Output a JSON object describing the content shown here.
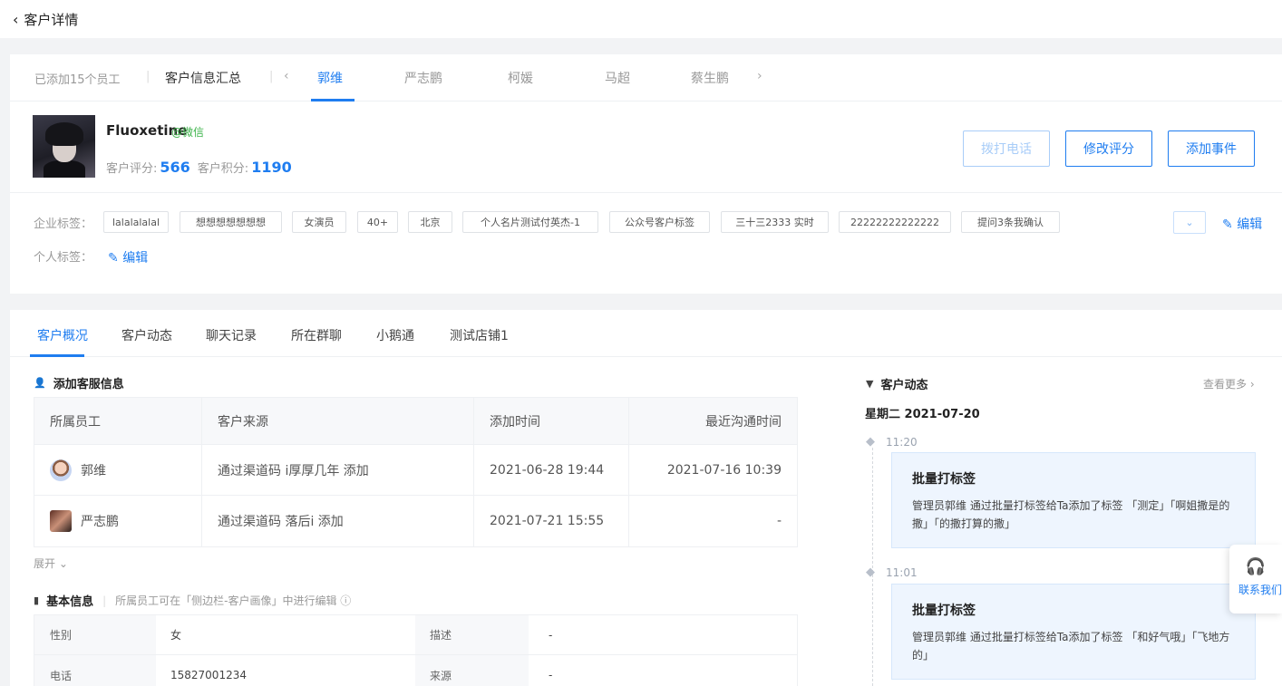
{
  "header": {
    "back_icon": "‹",
    "title": "客户详情"
  },
  "employees": {
    "added_text": "已添加15个员工",
    "summary_label": "客户信息汇总",
    "prev_arrow": "‹",
    "next_arrow": "›",
    "tabs": [
      "郭维",
      "严志鹏",
      "柯媛",
      "马超",
      "蔡生鹏"
    ],
    "active_index": 0
  },
  "customer": {
    "name": "Fluoxetine",
    "source": "@微信",
    "score_label": "客户评分:",
    "score": "566",
    "points_label": "客户积分:",
    "points": "1190"
  },
  "actions": {
    "call": "拨打电话",
    "modify_score": "修改评分",
    "add_event": "添加事件"
  },
  "tags": {
    "enterprise_label": "企业标签：",
    "personal_label": "个人标签：",
    "edit": "编辑",
    "enterprise": [
      "lalalalalal",
      "想想想想想想想",
      "女演员",
      "40+",
      "北京",
      "个人名片测试付英杰-1",
      "公众号客户标签",
      "三十三2333 实时",
      "22222222222222",
      "提问3条我确认"
    ]
  },
  "main_tabs": [
    "客户概况",
    "客户动态",
    "聊天记录",
    "所在群聊",
    "小鹅通",
    "测试店铺1"
  ],
  "service": {
    "title": "添加客服信息",
    "columns": [
      "所属员工",
      "客户来源",
      "添加时间",
      "最近沟通时间"
    ],
    "rows": [
      {
        "employee": "郭维",
        "source": "通过渠道码 i厚厚几年 添加",
        "added": "2021-06-28 19:44",
        "last": "2021-07-16 10:39"
      },
      {
        "employee": "严志鹏",
        "source": "通过渠道码 落后i 添加",
        "added": "2021-07-21 15:55",
        "last": "-"
      }
    ],
    "expand": "展开"
  },
  "basic": {
    "title": "基本信息",
    "note": "所属员工可在「侧边栏-客户画像」中进行编辑",
    "rows": [
      {
        "k1": "性别",
        "v1": "女",
        "k2": "描述",
        "v2": "-"
      },
      {
        "k1": "电话",
        "v1": "15827001234",
        "k2": "来源",
        "v2": "-"
      }
    ]
  },
  "activity": {
    "title": "客户动态",
    "more": "查看更多",
    "date": "星期二 2021-07-20",
    "events": [
      {
        "time": "11:20",
        "title": "批量打标签",
        "desc": "管理员郭维  通过批量打标签给Ta添加了标签 「测定」「啊姐撒是的撒」「的撒打算的撒」"
      },
      {
        "time": "11:01",
        "title": "批量打标签",
        "desc": "管理员郭维  通过批量打标签给Ta添加了标签 「和好气哦」「飞地方的」"
      }
    ]
  },
  "contact": {
    "label": "联系我们"
  },
  "colors": {
    "primary": "#1f7df0",
    "wechat_green": "#3cb34a",
    "background": "#f2f3f5"
  }
}
